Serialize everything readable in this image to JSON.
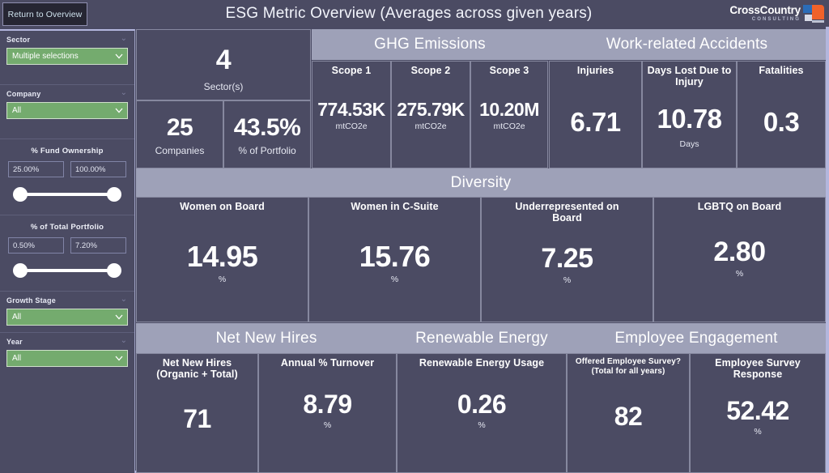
{
  "header": {
    "return_button": "Return to Overview",
    "title": "ESG Metric Overview (Averages across given years)",
    "logo_name": "CrossCountry",
    "logo_sub": "CONSULTING",
    "logo_blue": "#2b6cb8",
    "logo_orange": "#f0622a"
  },
  "sidebar": {
    "sector": {
      "label": "Sector",
      "value": "Multiple selections"
    },
    "company": {
      "label": "Company",
      "value": "All"
    },
    "fund_ownership": {
      "label": "% Fund Ownership",
      "min": "25.00%",
      "max": "100.00%"
    },
    "total_portfolio": {
      "label": "% of Total Portfolio",
      "min": "0.50%",
      "max": "7.20%"
    },
    "growth_stage": {
      "label": "Growth Stage",
      "value": "All"
    },
    "year": {
      "label": "Year",
      "value": "All"
    }
  },
  "summary": {
    "sectors": {
      "value": "4",
      "label": "Sector(s)"
    },
    "companies": {
      "value": "25",
      "label": "Companies"
    },
    "portfolio": {
      "value": "43.5%",
      "label": "% of Portfolio"
    }
  },
  "bands": {
    "ghg": "GHG Emissions",
    "accidents": "Work-related Accidents",
    "diversity": "Diversity",
    "net_new_hires": "Net New Hires",
    "renewable_energy": "Renewable Energy",
    "employee_engagement": "Employee Engagement"
  },
  "ghg_cards": [
    {
      "title": "Scope 1",
      "value": "774.53K",
      "unit": "mtCO2e"
    },
    {
      "title": "Scope 2",
      "value": "275.79K",
      "unit": "mtCO2e"
    },
    {
      "title": "Scope 3",
      "value": "10.20M",
      "unit": "mtCO2e"
    }
  ],
  "accident_cards": [
    {
      "title": "Injuries",
      "value": "6.71",
      "unit": ""
    },
    {
      "title": "Days Lost Due to Injury",
      "value": "10.78",
      "unit": "Days"
    },
    {
      "title": "Fatalities",
      "value": "0.3",
      "unit": ""
    }
  ],
  "diversity_cards": [
    {
      "title": "Women on Board",
      "value": "14.95",
      "unit": "%"
    },
    {
      "title": "Women in C-Suite",
      "value": "15.76",
      "unit": "%"
    },
    {
      "title": "Underrepresented on Board",
      "value": "7.25",
      "unit": "%"
    },
    {
      "title": "LGBTQ on Board",
      "value": "2.80",
      "unit": "%"
    }
  ],
  "bottom_cards": [
    {
      "title": "Net New Hires (Organic + Total)",
      "value": "71",
      "unit": ""
    },
    {
      "title": "Annual % Turnover",
      "value": "8.79",
      "unit": "%"
    },
    {
      "title": "Renewable Energy Usage",
      "value": "0.26",
      "unit": "%"
    },
    {
      "title": "Offered Employee Survey? (Total for all years)",
      "value": "82",
      "unit": ""
    },
    {
      "title": "Employee Survey Response",
      "value": "52.42",
      "unit": "%"
    }
  ],
  "chart_data": {
    "type": "table",
    "title": "ESG Metric Overview (Averages across given years)",
    "groups": [
      {
        "name": "Portfolio Summary",
        "metrics": [
          {
            "label": "Sector(s)",
            "value": 4,
            "unit": ""
          },
          {
            "label": "Companies",
            "value": 25,
            "unit": ""
          },
          {
            "label": "% of Portfolio",
            "value": 43.5,
            "unit": "%"
          }
        ]
      },
      {
        "name": "GHG Emissions",
        "metrics": [
          {
            "label": "Scope 1",
            "value": 774530,
            "display": "774.53K",
            "unit": "mtCO2e"
          },
          {
            "label": "Scope 2",
            "value": 275790,
            "display": "275.79K",
            "unit": "mtCO2e"
          },
          {
            "label": "Scope 3",
            "value": 10200000,
            "display": "10.20M",
            "unit": "mtCO2e"
          }
        ]
      },
      {
        "name": "Work-related Accidents",
        "metrics": [
          {
            "label": "Injuries",
            "value": 6.71,
            "unit": ""
          },
          {
            "label": "Days Lost Due to Injury",
            "value": 10.78,
            "unit": "Days"
          },
          {
            "label": "Fatalities",
            "value": 0.3,
            "unit": ""
          }
        ]
      },
      {
        "name": "Diversity",
        "metrics": [
          {
            "label": "Women on Board",
            "value": 14.95,
            "unit": "%"
          },
          {
            "label": "Women in C-Suite",
            "value": 15.76,
            "unit": "%"
          },
          {
            "label": "Underrepresented on Board",
            "value": 7.25,
            "unit": "%"
          },
          {
            "label": "LGBTQ on Board",
            "value": 2.8,
            "unit": "%"
          }
        ]
      },
      {
        "name": "Net New Hires",
        "metrics": [
          {
            "label": "Net New Hires (Organic + Total)",
            "value": 71,
            "unit": ""
          },
          {
            "label": "Annual % Turnover",
            "value": 8.79,
            "unit": "%"
          }
        ]
      },
      {
        "name": "Renewable Energy",
        "metrics": [
          {
            "label": "Renewable Energy Usage",
            "value": 0.26,
            "unit": "%"
          }
        ]
      },
      {
        "name": "Employee Engagement",
        "metrics": [
          {
            "label": "Offered Employee Survey? (Total for all years)",
            "value": 82,
            "unit": ""
          },
          {
            "label": "Employee Survey Response",
            "value": 52.42,
            "unit": "%"
          }
        ]
      }
    ],
    "filters": {
      "Sector": "Multiple selections",
      "Company": "All",
      "% Fund Ownership": [
        25.0,
        100.0
      ],
      "% of Total Portfolio": [
        0.5,
        7.2
      ],
      "Growth Stage": "All",
      "Year": "All"
    }
  }
}
